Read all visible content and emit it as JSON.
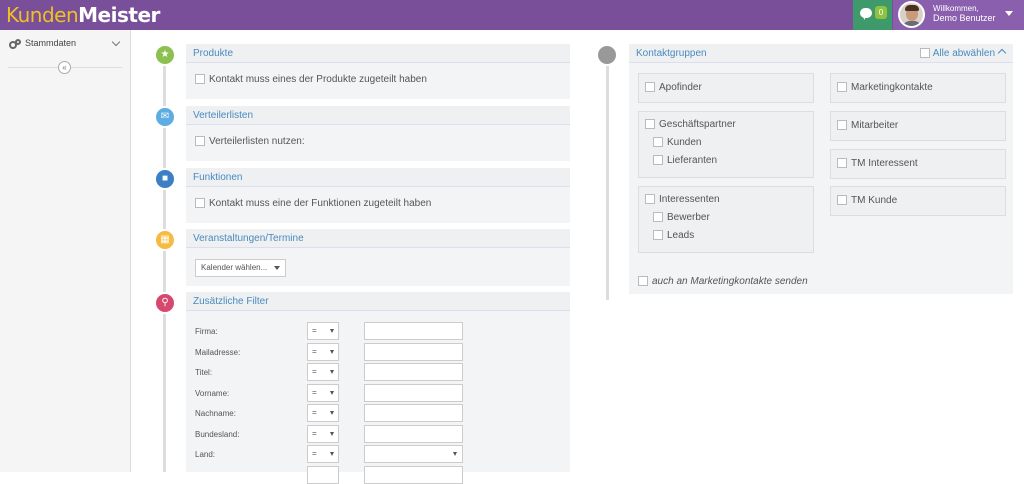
{
  "app": {
    "logo_part1": "Kunden",
    "logo_part2": "Meister",
    "chat_count": "0",
    "welcome": "Willkommen,",
    "user_name": "Demo Benutzer"
  },
  "sidebar": {
    "item_label": "Stammdaten"
  },
  "sections": {
    "produkte": {
      "title": "Produkte",
      "checkbox": "Kontakt muss eines der Produkte zugeteilt haben"
    },
    "verteiler": {
      "title": "Verteilerlisten",
      "checkbox": "Verteilerlisten nutzen:"
    },
    "funktionen": {
      "title": "Funktionen",
      "checkbox": "Kontakt muss eine der Funktionen zugeteilt haben"
    },
    "veranstaltungen": {
      "title": "Veranstaltungen/Termine",
      "select": "Kalender wählen..."
    },
    "filter": {
      "title": "Zusätzliche Filter",
      "operator": "=",
      "fields": [
        "Firma:",
        "Mailadresse:",
        "Titel:",
        "Vorname:",
        "Nachname:",
        "Bundesland:",
        "Land:"
      ]
    }
  },
  "kontaktgruppen": {
    "title": "Kontaktgruppen",
    "select_all": "Alle abwählen",
    "groups": {
      "apofinder": "Apofinder",
      "marketingkontakte": "Marketingkontakte",
      "geschaeftspartner": "Geschäftspartner",
      "kunden": "Kunden",
      "lieferanten": "Lieferanten",
      "mitarbeiter": "Mitarbeiter",
      "tm_interessent": "TM Interessent",
      "interessenten": "Interessenten",
      "bewerber": "Bewerber",
      "leads": "Leads",
      "tm_kunde": "TM Kunde"
    },
    "footer": "auch an Marketingkontakte senden"
  }
}
